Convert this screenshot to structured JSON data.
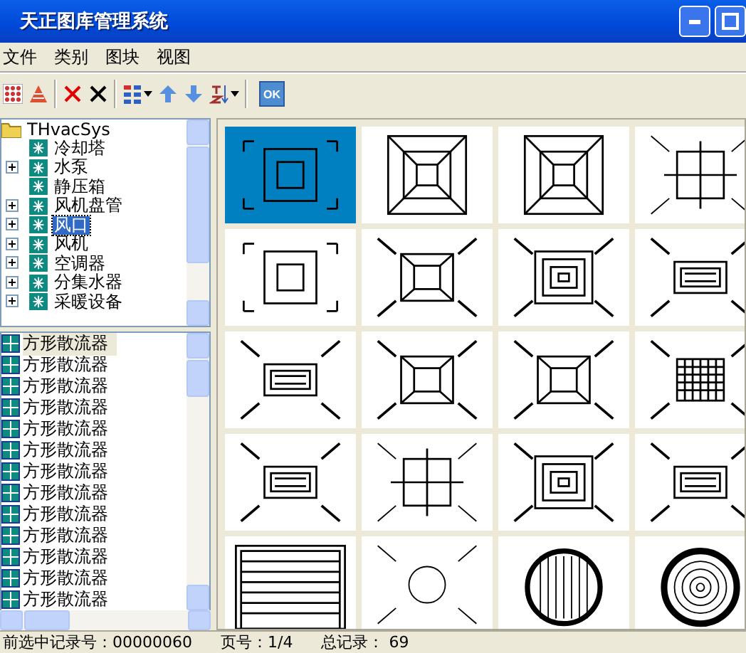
{
  "window": {
    "title": "天正图库管理系统"
  },
  "menu": [
    "文件",
    "类别",
    "图块",
    "视图"
  ],
  "toolbar": {
    "ok_label": "OK"
  },
  "tree": {
    "root": "THvacSys",
    "children": [
      {
        "label": "冷却塔",
        "expandable": false,
        "selected": false
      },
      {
        "label": "水泵",
        "expandable": true,
        "selected": false
      },
      {
        "label": "静压箱",
        "expandable": false,
        "selected": false
      },
      {
        "label": "风机盘管",
        "expandable": true,
        "selected": false
      },
      {
        "label": "风口",
        "expandable": true,
        "selected": true
      },
      {
        "label": "风机",
        "expandable": true,
        "selected": false
      },
      {
        "label": "空调器",
        "expandable": true,
        "selected": false
      },
      {
        "label": "分集水器",
        "expandable": true,
        "selected": false
      },
      {
        "label": "采暖设备",
        "expandable": true,
        "selected": false
      }
    ]
  },
  "blocks": [
    {
      "label": "方形散流器",
      "selected": true
    },
    {
      "label": "方形散流器",
      "selected": false
    },
    {
      "label": "方形散流器",
      "selected": false
    },
    {
      "label": "方形散流器",
      "selected": false
    },
    {
      "label": "方形散流器",
      "selected": false
    },
    {
      "label": "方形散流器",
      "selected": false
    },
    {
      "label": "方形散流器",
      "selected": false
    },
    {
      "label": "方形散流器",
      "selected": false
    },
    {
      "label": "方形散流器",
      "selected": false
    },
    {
      "label": "方形散流器",
      "selected": false
    },
    {
      "label": "方形散流器",
      "selected": false
    },
    {
      "label": "方形散流器",
      "selected": false
    },
    {
      "label": "方形散流器",
      "selected": false
    }
  ],
  "previews": [
    {
      "kind": "corners",
      "selected": true
    },
    {
      "kind": "pyramid",
      "selected": false
    },
    {
      "kind": "pyramid",
      "selected": false
    },
    {
      "kind": "cross",
      "selected": false
    },
    {
      "kind": "corners",
      "selected": false
    },
    {
      "kind": "square",
      "selected": false
    },
    {
      "kind": "nested",
      "selected": false
    },
    {
      "kind": "rect",
      "selected": false
    },
    {
      "kind": "rect",
      "selected": false
    },
    {
      "kind": "square",
      "selected": false
    },
    {
      "kind": "square",
      "selected": false
    },
    {
      "kind": "grid",
      "selected": false
    },
    {
      "kind": "rect",
      "selected": false
    },
    {
      "kind": "cross",
      "selected": false
    },
    {
      "kind": "nested",
      "selected": false
    },
    {
      "kind": "rect",
      "selected": false
    },
    {
      "kind": "louver",
      "selected": false
    },
    {
      "kind": "round",
      "selected": false
    },
    {
      "kind": "hatched",
      "selected": false
    },
    {
      "kind": "rings",
      "selected": false
    }
  ],
  "status_bar": {
    "record": "前选中记录号：00000060",
    "page": "页号：1/4",
    "total": "总记录： 69"
  }
}
